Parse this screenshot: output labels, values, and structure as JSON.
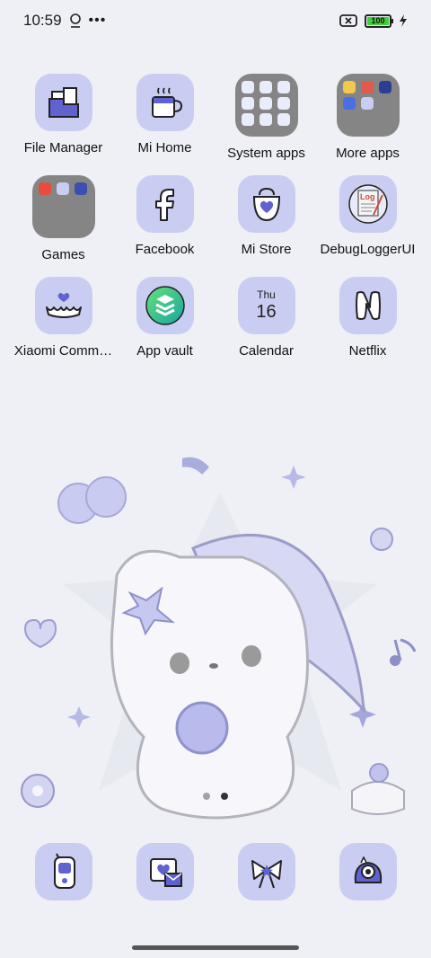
{
  "status_bar": {
    "time": "10:59",
    "battery_level": "100"
  },
  "apps": [
    {
      "name": "file-manager-app",
      "label": "File Manager",
      "icon": "folder-document-icon"
    },
    {
      "name": "mi-home-app",
      "label": "Mi Home",
      "icon": "coffee-mug-icon"
    },
    {
      "name": "system-apps-folder",
      "label": "System apps",
      "icon": "folder-icon"
    },
    {
      "name": "more-apps-folder",
      "label": "More apps",
      "icon": "folder-icon"
    },
    {
      "name": "games-folder",
      "label": "Games",
      "icon": "folder-icon"
    },
    {
      "name": "facebook-app",
      "label": "Facebook",
      "icon": "facebook-f-icon"
    },
    {
      "name": "mi-store-app",
      "label": "Mi Store",
      "icon": "shopping-bag-heart-icon"
    },
    {
      "name": "debuglogger-app",
      "label": "DebugLoggerUI",
      "icon": "log-icon"
    },
    {
      "name": "xiaomi-community-app",
      "label": "Xiaomi Comm…",
      "icon": "crown-icon"
    },
    {
      "name": "app-vault-app",
      "label": "App vault",
      "icon": "layers-icon"
    },
    {
      "name": "calendar-app",
      "label": "Calendar",
      "icon": "calendar-icon",
      "day": "Thu",
      "date": "16"
    },
    {
      "name": "netflix-app",
      "label": "Netflix",
      "icon": "netflix-n-icon"
    }
  ],
  "dock": [
    {
      "name": "phone-app",
      "icon": "walkie-phone-icon"
    },
    {
      "name": "messages-app",
      "icon": "heart-envelope-icon"
    },
    {
      "name": "theme-app",
      "icon": "bow-icon"
    },
    {
      "name": "camera-app",
      "icon": "camera-creature-icon"
    }
  ],
  "colors": {
    "tile": "#c9cdf2",
    "accent": "#6c70d8",
    "folder": "#858585",
    "wallpaper": "#eef0f5"
  }
}
